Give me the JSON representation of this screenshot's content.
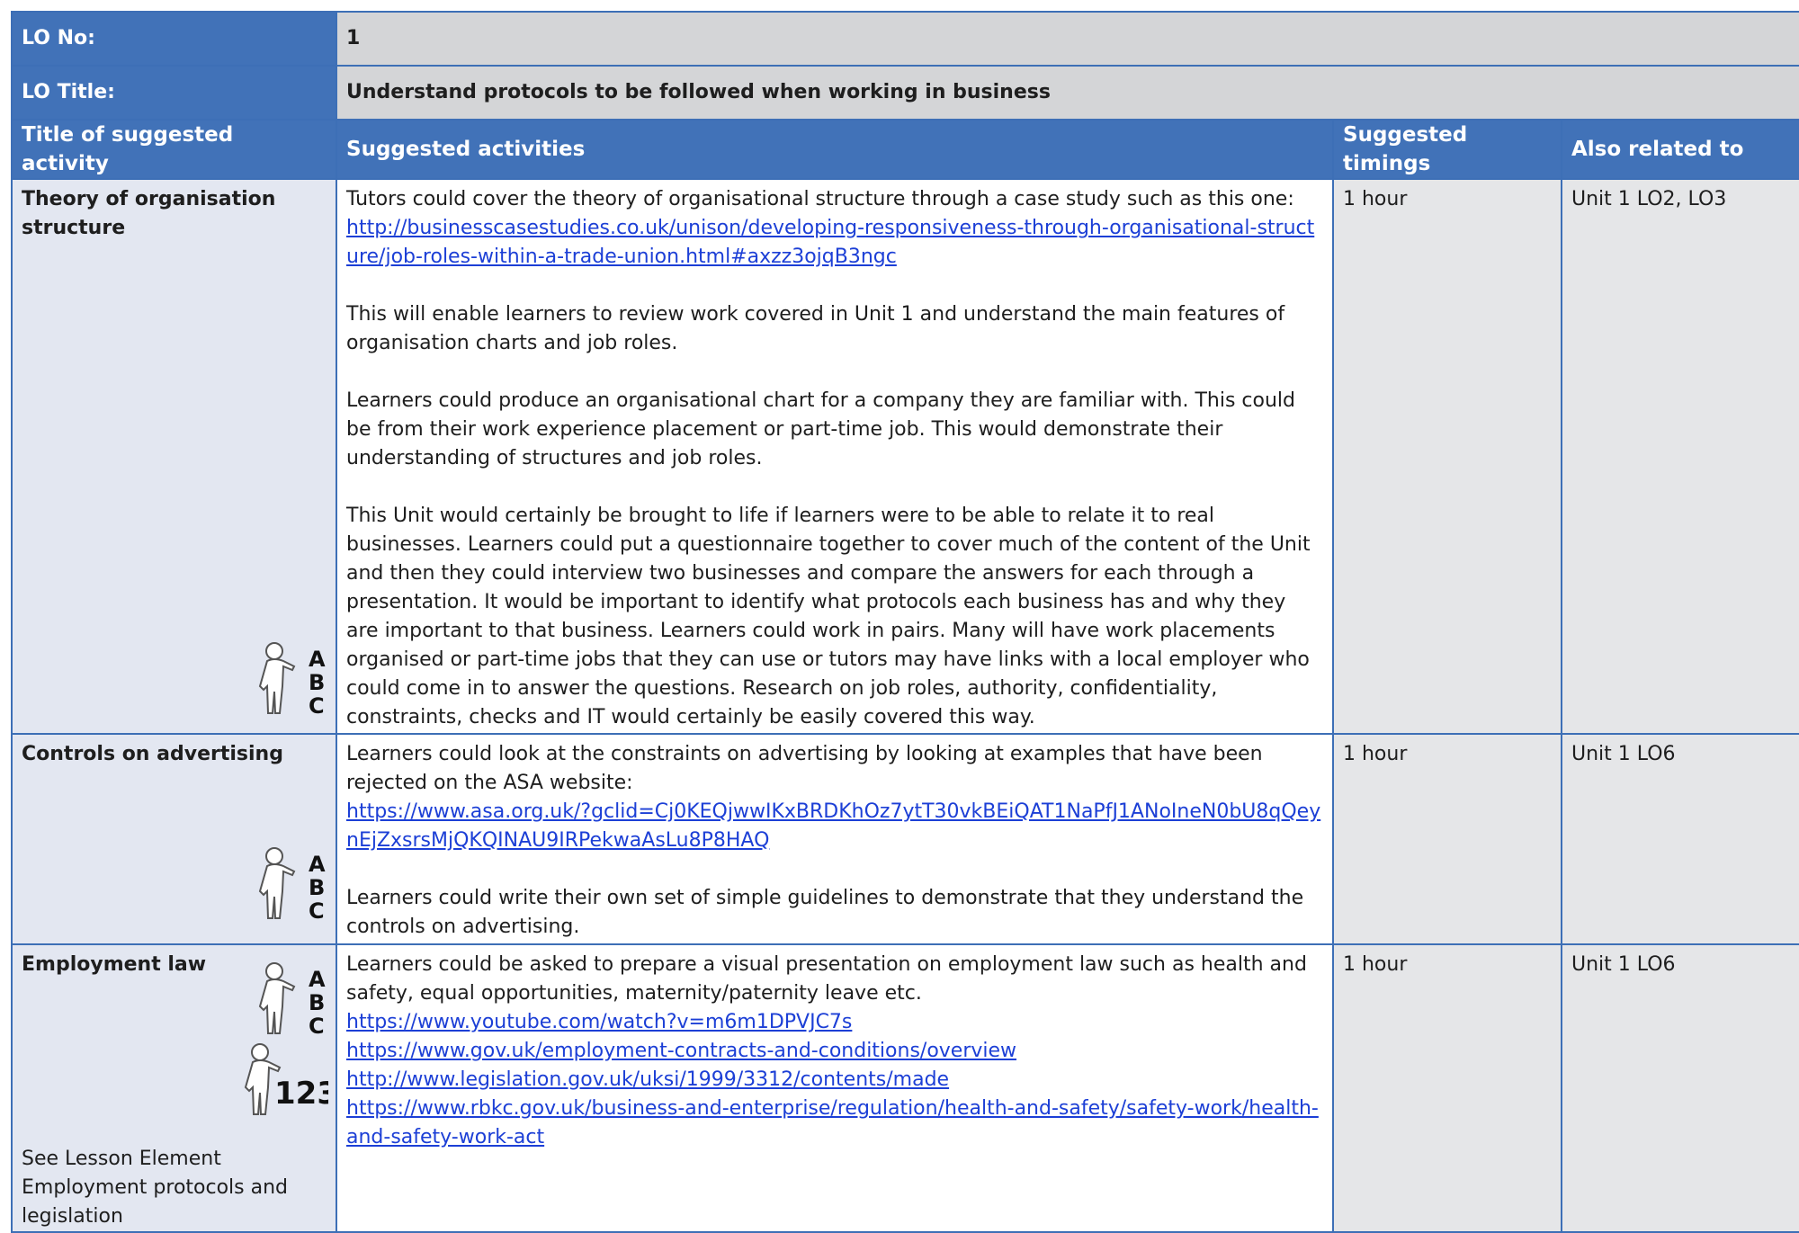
{
  "header": {
    "lo_no_label": "LO No:",
    "lo_no_value": "1",
    "lo_title_label": "LO Title:",
    "lo_title_value": "Understand protocols to be followed when working in business"
  },
  "columns": {
    "title": "Title of suggested activity",
    "activities": "Suggested activities",
    "timings": "Suggested timings",
    "related": "Also related to"
  },
  "rows": [
    {
      "title": "Theory of organisation structure",
      "p1": "Tutors could cover the theory of organisational structure through a case study such as this one:",
      "link1": "http://businesscasestudies.co.uk/unison/developing-responsiveness-through-organisational-structure/job-roles-within-a-trade-union.html#axzz3ojqB3ngc",
      "p2": "This will enable learners to review work covered in Unit 1 and understand the main features of organisation charts and job roles.",
      "p3": "Learners could produce an organisational chart for a company they are familiar with. This could be from their work experience placement or part-time job. This would demonstrate their understanding of structures and job roles.",
      "p4": "This Unit would certainly be brought to life if learners were to be able to relate it to real businesses. Learners could put a questionnaire together to cover much of the content of the Unit and then they could interview two businesses and compare the answers for each through a presentation. It would be important to identify what protocols each business has and why they are important to that business. Learners could work in pairs. Many will have work placements organised or part-time jobs that they can use or tutors may have links with a local employer who could come in to answer the questions. Research on job roles, authority, confidentiality, constraints, checks and IT would certainly be easily covered this way.",
      "timing": "1 hour",
      "related": "Unit 1 LO2, LO3",
      "icon": "literacy-abc-icon"
    },
    {
      "title": "Controls on advertising",
      "p1": "Learners could look at the constraints on advertising by looking at examples that have been rejected on the ASA website:",
      "link1": "https://www.asa.org.uk/?gclid=Cj0KEQjwwIKxBRDKhOz7ytT30vkBEiQAT1NaPfJ1ANoIneN0bU8qQeynEjZxsrsMjQKQINAU9IRPekwaAsLu8P8HAQ",
      "p2": "Learners could write their own set of simple guidelines to demonstrate that they understand the controls on advertising.",
      "timing": "1 hour",
      "related": "Unit 1 LO6",
      "icon": "literacy-abc-icon"
    },
    {
      "title": "Employment law",
      "p1": "Learners could be asked to prepare a visual presentation on employment law such as health and safety, equal opportunities, maternity/paternity leave etc.",
      "links": [
        "https://www.youtube.com/watch?v=m6m1DPVJC7s",
        "https://www.gov.uk/employment-contracts-and-conditions/overview",
        "http://www.legislation.gov.uk/uksi/1999/3312/contents/made",
        "https://www.rbkc.gov.uk/business-and-enterprise/regulation/health-and-safety/safety-work/health-and-safety-work-act"
      ],
      "note": "See Lesson Element Employment protocols and legislation",
      "timing": "1 hour",
      "related": "Unit 1 LO6",
      "icons": [
        "literacy-abc-icon",
        "numeracy-123-icon"
      ]
    }
  ],
  "colors": {
    "header_blue": "#4172b8",
    "header_grey": "#d4d5d7",
    "title_cell_bg": "#e3e7f1",
    "grey_cell_bg": "#e5e6e8",
    "link": "#1c3fd6"
  }
}
